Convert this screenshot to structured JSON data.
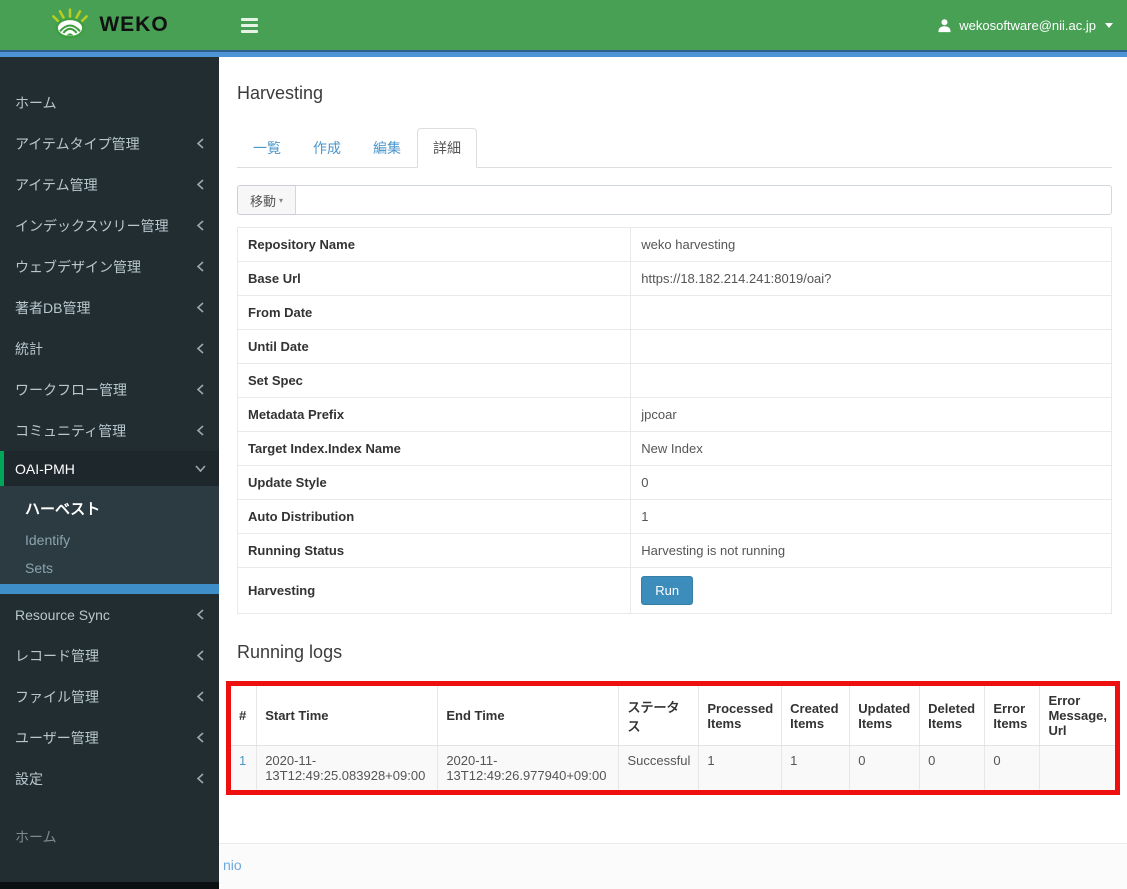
{
  "brand": {
    "name": "WEKO"
  },
  "header": {
    "user_email": "wekosoftware@nii.ac.jp"
  },
  "colors": {
    "green": "#48a055",
    "accent_blue": "#4d94d6",
    "link_blue": "#4c96cb",
    "btn_blue": "#3c8dbc",
    "annotation_red": "#ee0f0f"
  },
  "sidebar": {
    "items": [
      {
        "key": "home",
        "label": "ホーム",
        "chevron": null
      },
      {
        "key": "item-type-management",
        "label": "アイテムタイプ管理",
        "chevron": "left"
      },
      {
        "key": "item-management",
        "label": "アイテム管理",
        "chevron": "left"
      },
      {
        "key": "index-tree-management",
        "label": "インデックスツリー管理",
        "chevron": "left"
      },
      {
        "key": "web-design-management",
        "label": "ウェブデザイン管理",
        "chevron": "left"
      },
      {
        "key": "author-db-management",
        "label": "著者DB管理",
        "chevron": "left"
      },
      {
        "key": "statistics",
        "label": "統計",
        "chevron": "left"
      },
      {
        "key": "workflow-management",
        "label": "ワークフロー管理",
        "chevron": "left"
      },
      {
        "key": "community-management",
        "label": "コミュニティ管理",
        "chevron": "left"
      },
      {
        "key": "oai-pmh",
        "label": "OAI-PMH",
        "chevron": "down",
        "active": true,
        "children": [
          {
            "key": "harvest",
            "label": "ハーベスト",
            "active": true
          },
          {
            "key": "identify",
            "label": "Identify",
            "active": false
          },
          {
            "key": "sets",
            "label": "Sets",
            "active": false
          }
        ]
      },
      {
        "key": "resource-sync",
        "label": "Resource Sync",
        "chevron": "left"
      },
      {
        "key": "record-management",
        "label": "レコード管理",
        "chevron": "left"
      },
      {
        "key": "file-management",
        "label": "ファイル管理",
        "chevron": "left"
      },
      {
        "key": "user-management",
        "label": "ユーザー管理",
        "chevron": "left"
      },
      {
        "key": "settings",
        "label": "設定",
        "chevron": "left"
      }
    ],
    "footer_home": "ホーム"
  },
  "main": {
    "title": "Harvesting",
    "tabs": [
      {
        "key": "list",
        "label": "一覧",
        "active": false
      },
      {
        "key": "create",
        "label": "作成",
        "active": false
      },
      {
        "key": "edit",
        "label": "編集",
        "active": false
      },
      {
        "key": "detail",
        "label": "詳細",
        "active": true
      }
    ],
    "move_label": "移動",
    "move_input_value": "",
    "details": {
      "rows": [
        {
          "label": "Repository Name",
          "value": "weko harvesting"
        },
        {
          "label": "Base Url",
          "value": "https://18.182.214.241:8019/oai?"
        },
        {
          "label": "From Date",
          "value": ""
        },
        {
          "label": "Until Date",
          "value": ""
        },
        {
          "label": "Set Spec",
          "value": ""
        },
        {
          "label": "Metadata Prefix",
          "value": "jpcoar"
        },
        {
          "label": "Target Index.Index Name",
          "value": "New Index"
        },
        {
          "label": "Update Style",
          "value": "0"
        },
        {
          "label": "Auto Distribution",
          "value": "1"
        },
        {
          "label": "Running Status",
          "value": "Harvesting is not running"
        },
        {
          "label": "Harvesting",
          "value": "",
          "button": "Run"
        }
      ]
    },
    "logs": {
      "title": "Running logs",
      "columns": [
        "#",
        "Start Time",
        "End Time",
        "ステータス",
        "Processed Items",
        "Created Items",
        "Updated Items",
        "Deleted Items",
        "Error Items",
        "Error Message, Url"
      ],
      "rows": [
        [
          "1",
          "2020-11-13T12:49:25.083928+09:00",
          "2020-11-13T12:49:26.977940+09:00",
          "Successful",
          "1",
          "1",
          "0",
          "0",
          "0",
          ""
        ]
      ]
    }
  },
  "footer": {
    "link_text": "nio"
  }
}
